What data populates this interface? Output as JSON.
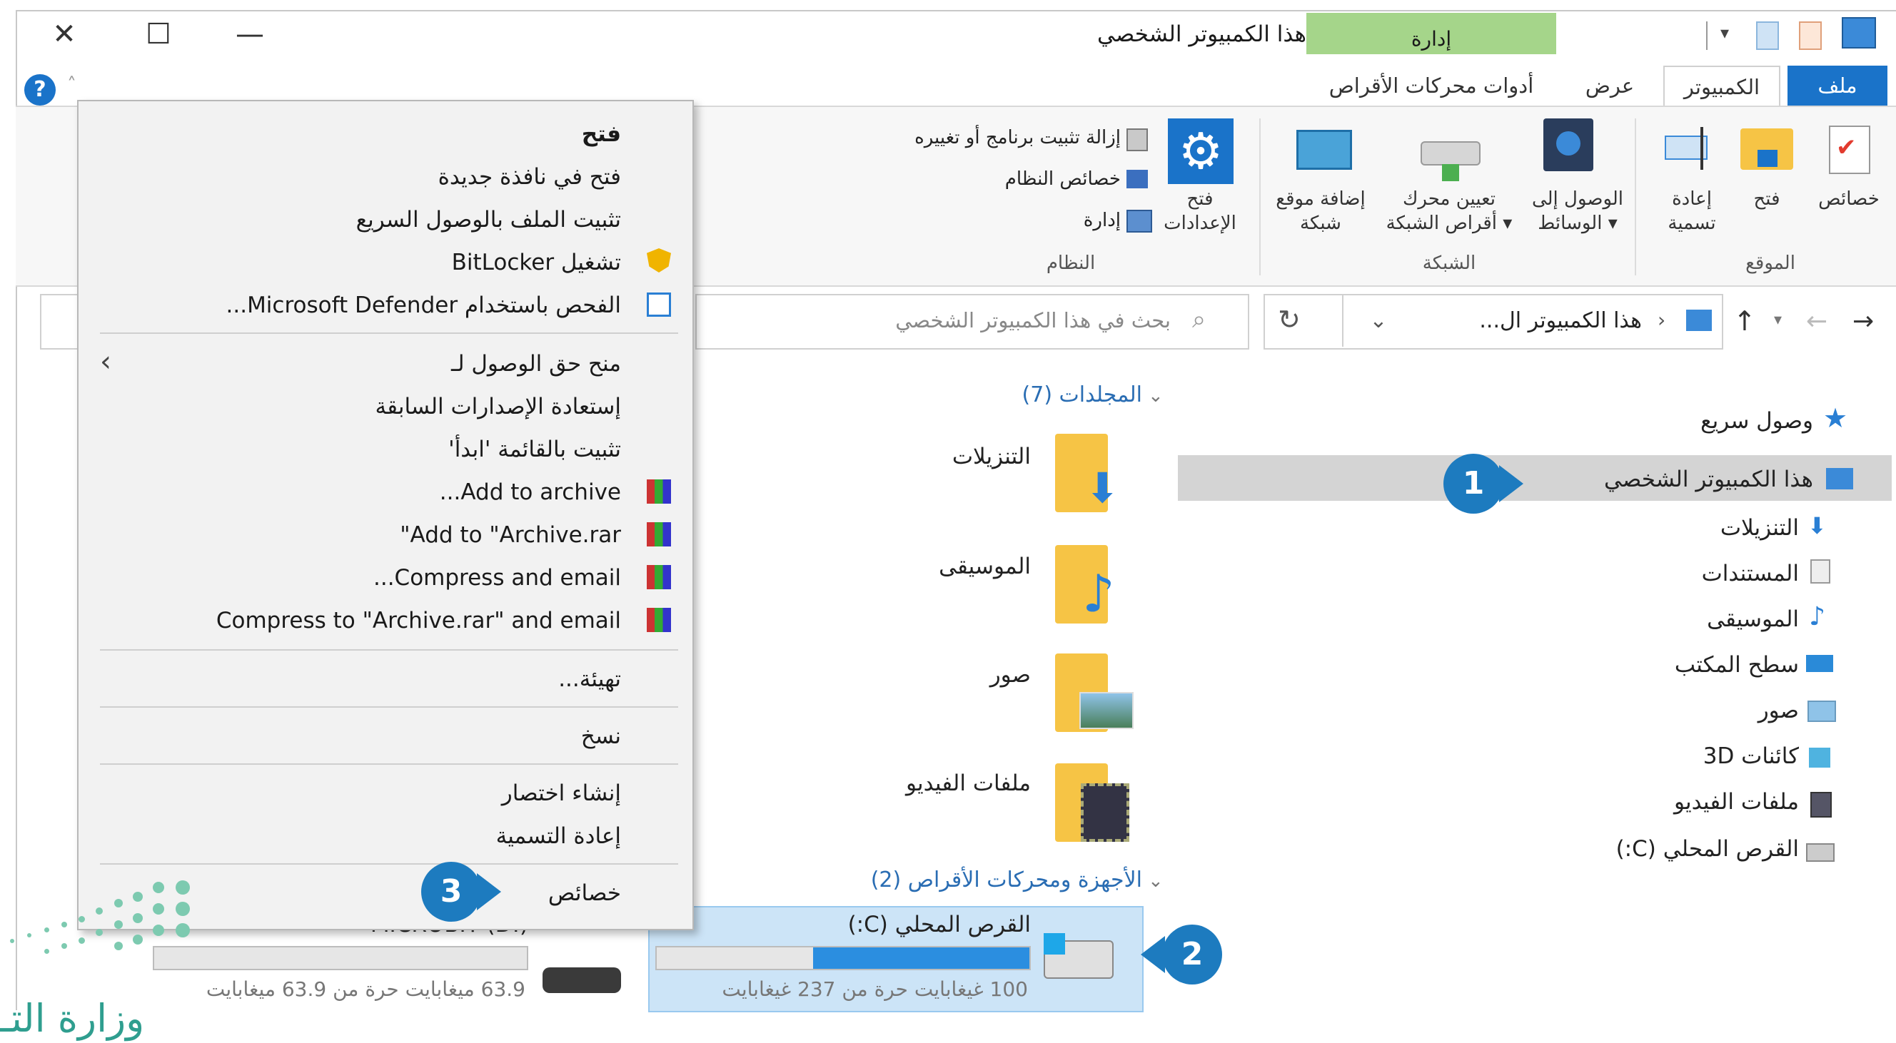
{
  "window": {
    "title": "هذا الكمبيوتر الشخصي",
    "manage_tab": "إدارة",
    "controls": {
      "close": "✕",
      "maximize": "☐",
      "minimize": "—"
    }
  },
  "tabs": [
    {
      "label": "ملف"
    },
    {
      "label": "الكمبيوتر"
    },
    {
      "label": "عرض"
    },
    {
      "label": "أدوات محركات الأقراص"
    }
  ],
  "ribbon": {
    "location_group": "الموقع",
    "network_group": "الشبكة",
    "system_group": "النظام",
    "properties": "خصائص",
    "open": "فتح",
    "rename": "إعادة\nتسمية",
    "access_media": "الوصول إلى\nالوسائط ▾",
    "map_drive": "تعيين محرك\nأقراص الشبكة ▾",
    "add_location": "إضافة موقع\nشبكة",
    "open_settings": "فتح\nالإعدادات",
    "uninstall": "إزالة تثبيت برنامج أو تغييره",
    "system_properties": "خصائص النظام",
    "manage": "إدارة"
  },
  "address": {
    "path": "هذا الكمبيوتر ال...",
    "search_placeholder": "بحث في هذا الكمبيوتر الشخصي"
  },
  "nav": {
    "quick_access": "وصول سريع",
    "this_pc": "هذا الكمبيوتر الشخصي",
    "items": [
      {
        "label": "التنزيلات"
      },
      {
        "label": "المستندات"
      },
      {
        "label": "الموسيقى"
      },
      {
        "label": "سطح المكتب"
      },
      {
        "label": "صور"
      },
      {
        "label": "كائنات 3D"
      },
      {
        "label": "ملفات الفيديو"
      },
      {
        "label": "القرص المحلي (C:)"
      }
    ]
  },
  "content": {
    "folders_header": "المجلدات (7)",
    "folders": [
      {
        "label": "التنزيلات"
      },
      {
        "label": "الموسيقى"
      },
      {
        "label": "صور"
      },
      {
        "label": "ملفات الفيديو"
      }
    ],
    "devices_header": "الأجهزة ومحركات الأقراص (2)",
    "drive_c": {
      "label": "القرص المحلي (C:)",
      "free": "100 غيغابايت حرة من 237 غيغابايت",
      "used_fraction": 0.58
    },
    "drive_d": {
      "label": "MICROBIT (D:)",
      "free": "63.9 ميغابايت حرة من 63.9 ميغابايت",
      "used_fraction": 0.0
    }
  },
  "context_menu": {
    "open": "فتح",
    "open_new_window": "فتح في نافذة جديدة",
    "pin_quick": "تثبيت الملف بالوصول السريع",
    "bitlocker": "تشغيل BitLocker",
    "defender": "الفحص باستخدام Microsoft Defender...",
    "give_access": "منح حق الوصول لـ",
    "restore": "إستعادة الإصدارات السابقة",
    "pin_start": "تثبيت بالقائمة 'ابدأ'",
    "add_archive": "Add to archive...",
    "add_archive_rar": "Add to \"Archive.rar\"",
    "compress_email": "Compress and email...",
    "compress_rar_email": "Compress to \"Archive.rar\" and email",
    "format": "تهيئة...",
    "copy": "نسخ",
    "shortcut": "إنشاء اختصار",
    "rename": "إعادة التسمية",
    "properties": "خصائص"
  },
  "callouts": {
    "one": "1",
    "two": "2",
    "three": "3"
  },
  "watermark": "وزارة التـ"
}
